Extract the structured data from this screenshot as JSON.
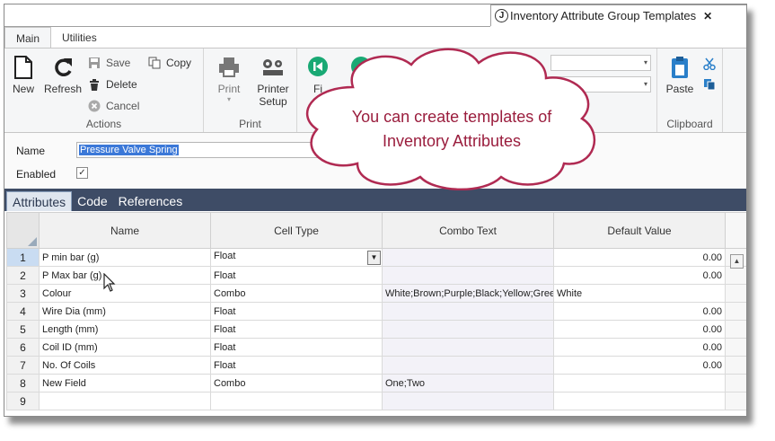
{
  "window": {
    "title": "Inventory Attribute Group Templates",
    "close_glyph": "✕",
    "app_icon_glyph": "J"
  },
  "ribbon_tabs": [
    {
      "label": "Main"
    },
    {
      "label": "Utilities"
    }
  ],
  "ribbon": {
    "actions": {
      "label": "Actions",
      "new": "New",
      "refresh": "Refresh",
      "save": "Save",
      "copy": "Copy",
      "delete": "Delete",
      "cancel": "Cancel"
    },
    "print": {
      "label": "Print",
      "print": "Print",
      "printer_setup_1": "Printer",
      "printer_setup_2": "Setup"
    },
    "nav": {
      "first_partial": "Fi"
    },
    "clipboard": {
      "label": "Clipboard",
      "paste": "Paste"
    }
  },
  "form": {
    "name_label": "Name",
    "name_value": "Pressure Valve Spring",
    "enabled_label": "Enabled",
    "enabled_checked": true
  },
  "detail_tabs": [
    {
      "label": "Attributes"
    },
    {
      "label": "Code"
    },
    {
      "label": "References"
    }
  ],
  "grid": {
    "columns": [
      "Name",
      "Cell Type",
      "Combo Text",
      "Default Value"
    ],
    "rows": [
      {
        "n": "1",
        "name": "P min bar (g)",
        "type": "Float",
        "combo": "",
        "default": "0.00"
      },
      {
        "n": "2",
        "name": "P Max bar (g)",
        "type": "Float",
        "combo": "",
        "default": "0.00"
      },
      {
        "n": "3",
        "name": "Colour",
        "type": "Combo",
        "combo": "White;Brown;Purple;Black;Yellow;Green",
        "default": "White"
      },
      {
        "n": "4",
        "name": "Wire Dia (mm)",
        "type": "Float",
        "combo": "",
        "default": "0.00"
      },
      {
        "n": "5",
        "name": "Length (mm)",
        "type": "Float",
        "combo": "",
        "default": "0.00"
      },
      {
        "n": "6",
        "name": "Coil ID (mm)",
        "type": "Float",
        "combo": "",
        "default": "0.00"
      },
      {
        "n": "7",
        "name": "No. Of Coils",
        "type": "Float",
        "combo": "",
        "default": "0.00"
      },
      {
        "n": "8",
        "name": "New Field",
        "type": "Combo",
        "combo": "One;Two",
        "default": ""
      },
      {
        "n": "9",
        "name": "",
        "type": "",
        "combo": "",
        "default": ""
      }
    ]
  },
  "callout": {
    "line1": "You can create templates of",
    "line2": "Inventory Attributes"
  },
  "colors": {
    "accent": "#3e4c66",
    "callout_text": "#9a1d3d",
    "nav_green": "#19a974",
    "selection": "#3b78d8"
  }
}
